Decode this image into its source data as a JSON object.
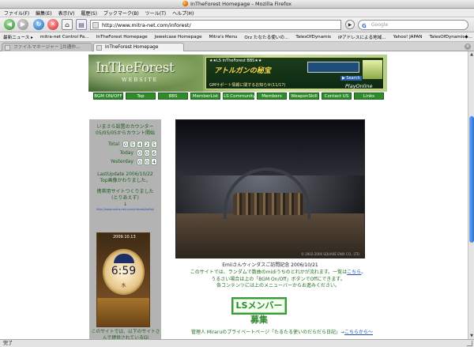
{
  "window": {
    "title": "InTheForest Homepage - Mozilla Firefox"
  },
  "menu": [
    "ファイル(F)",
    "編集(E)",
    "表示(V)",
    "履歴(S)",
    "ブックマーク(B)",
    "ツール(T)",
    "ヘルプ(H)"
  ],
  "nav": {
    "url": "http://www.mitra-net.com/inforest/",
    "go_label": "▶",
    "search_placeholder": "Google"
  },
  "bookmarks": [
    "最新ニュース ▸",
    "mitra-net Control Pa...",
    "InTheForest Homepage",
    "Jewelcase Homepage",
    "Mitra's Menu",
    "Orz たなたる使いの...",
    "TalesOfDynamis",
    "IPアドレスによる地域...",
    "Yahoo! JAPAN",
    "TalesOfDynamis◆..."
  ],
  "tabs": [
    {
      "label": "ファイルマネージャー [共通作..."
    },
    {
      "label": "InTheForest Homepage"
    }
  ],
  "status": "完了",
  "banner": {
    "logo": "InTheForest",
    "logo_sub": "WEBSITE",
    "ad_line1": "★★LS InTheForest BBS★★",
    "ad_main": "アトルガンの秘宝",
    "ad_line3": "GMサポート情報に関するお知らせ(11/17)",
    "ad_search": "▶ Search",
    "ad_playonline": "PlayOnline"
  },
  "navmenu": [
    "BGM ON/OFF",
    "Top",
    "BBS",
    "MemberList",
    "LS Community",
    "Members",
    "WeaponSkill",
    "Contact US",
    "Links"
  ],
  "sidebar": {
    "counter_title": "いまさら設置のカウンター",
    "counter_since": "05/05/05からカウント開始",
    "total_label": "Total",
    "total_digits": [
      "0",
      "5",
      "4",
      "2",
      "5"
    ],
    "today_label": "Today",
    "today_digits": [
      "0",
      "0",
      "6"
    ],
    "yesterday_label": "Yesterday",
    "yesterday_digits": [
      "0",
      "0",
      "4"
    ],
    "last_update": "LastUpdate 2006/10/22",
    "top_note": "Top画像かわりました。",
    "mobile_note": "携帯用サイトつくりました",
    "mobile_note2": "(とりあえず)",
    "down_arrow": "↓",
    "mobile_url": "http://www.mitra-net.com/inforest/keitai/",
    "watch_date": "2009.10.13",
    "watch_time": "6:59",
    "watch_num": "水",
    "bottom_note": "このサイトでは、以下のサイトさんで提供されているGI"
  },
  "main": {
    "caption": "Emiiさんウィンダスご訪問記念 2006/10/21",
    "desc1": "このサイトでは、ランダムで数曲のmidiうちのどれかが流れます。一覧は",
    "desc1_link": "こちら",
    "desc1_end": "。",
    "desc2": "うるさい場合は上の「BGM On/Off」ボタンでOffにできます。",
    "desc3": "各コンテンツには上のメニューバーからお進みください。",
    "ls_button": "LSメンバー募集",
    "admin": "管理人 Miraruのプライベートページ「たるたる使いのだらだら日記」→",
    "admin_link": "こちらから〜",
    "shot_sig": "© 2002-2006 SQUARE ENIX CO., LTD."
  }
}
